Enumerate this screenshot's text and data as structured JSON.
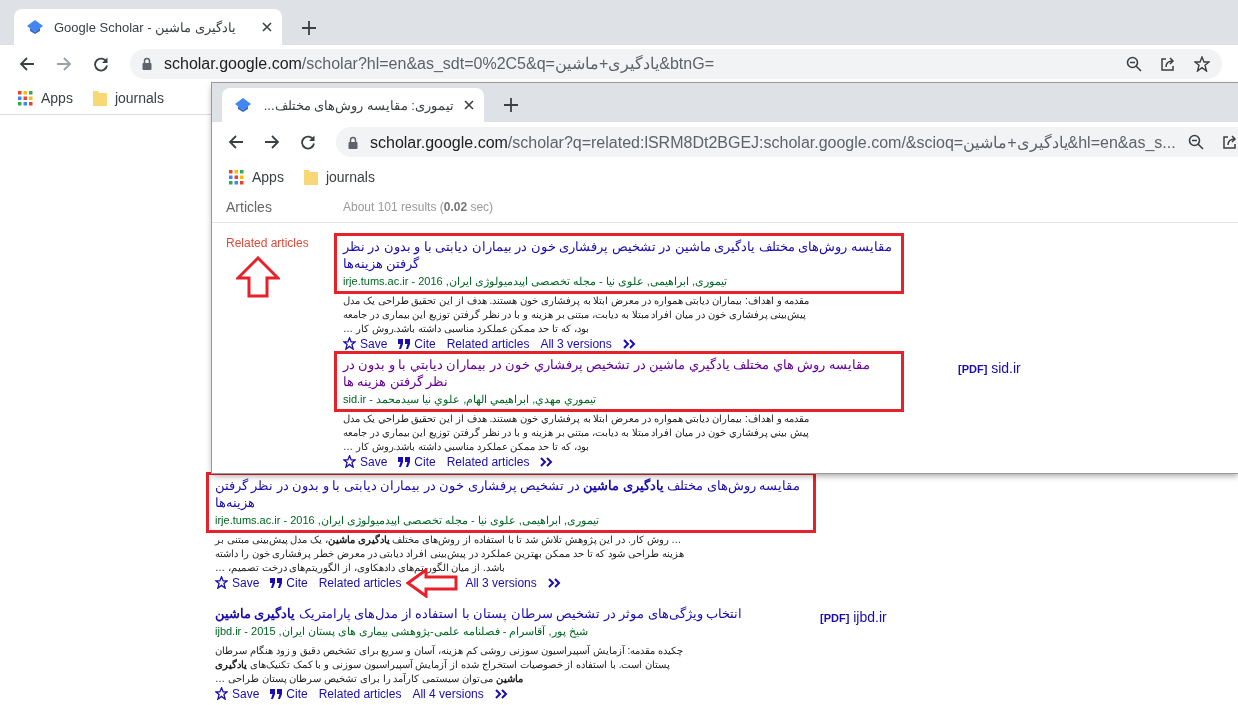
{
  "outer_window": {
    "tabs": [
      {
        "title": "Google Scholar - یادگیری ماشین",
        "selected": true
      }
    ],
    "url": {
      "host": "scholar.google.com",
      "path": "/scholar?hl=en&as_sdt=0%2C5&q=یادگیری+ماشین&btnG="
    },
    "bookmarks": {
      "apps": "Apps",
      "folder": "journals"
    },
    "results": [
      {
        "title": "مقایسه روش‌های مختلف **یادگیری ماشین** در تشخیص پرفشاری خون در بیماران دیابتی با و بدون در نظر گرفتن هزینه‌ها",
        "visited": false,
        "highlighted": true,
        "pointed_at": true,
        "authors": "تیموری, ابراهیمی, علوی نیا - مجله تخصصی اپیدمیولوژی ایران, 2016 - irje.tums.ac.ir",
        "snippet": "… روش کار. در این پژوهش تلاش شد تا با استفاده از روش‌های مختلف **یادگیری ماشین**، یک مدل پیش‌بینی مبتنی بر هزینه طراحی شود که تا حد ممکن بهترین عملکرد در پیش‌بینی افراد دیابتی در معرض خطر پرفشاری خون را داشته باشد. از میان الگوریتم‌های دادهکاوی، از الگوریتم‌های درخت تصمیم، …",
        "actions": {
          "save": "Save",
          "cite": "Cite",
          "related": "Related articles",
          "versions": "All 3 versions"
        }
      },
      {
        "title": "انتخاب ویژگی‌های موثر در تشخیص سرطان پستان با استفاده از مدل‌های پارامتریک **یادگیری ماشین**",
        "visited": false,
        "highlighted": false,
        "pdf_link": "**[PDF]** ijbd.ir",
        "authors": "شیخ پور, آقاسرام - فصلنامه علمی-پژوهشی بیماری های پستان ایران, 2015 - ijbd.ir",
        "snippet": "چکیده مقدمه: آزمایش آسپیراسیون سوزنی روشی کم هزینه، آسان و سریع برای تشخیص دقیق و زود هنگام سرطان پستان است. با استفاده از خصوصیات استخراج شده از آزمایش آسپیراسیون سوزنی و با کمک تکنیک‌های **یادگیری ماشین** می‌توان سیستمی کارآمد را برای تشخیص سرطان پستان طراحی …",
        "actions": {
          "save": "Save",
          "cite": "Cite",
          "related": "Related articles",
          "versions": "All 4 versions"
        }
      }
    ]
  },
  "inner_window": {
    "tabs": [
      {
        "title": "تیموری: مقایسه روش‌های مختلف...",
        "selected": true
      }
    ],
    "url": {
      "host": "scholar.google.com",
      "path": "/scholar?q=related:lSRM8Dt2BGEJ:scholar.google.com/&scioq=یادگیری+ماشین&hl=en&as_s..."
    },
    "bookmarks": {
      "apps": "Apps",
      "folder": "journals"
    },
    "section": "Articles",
    "result_stats": "About 101 results (**0.02** sec)",
    "sidebar_link": "Related articles",
    "sidebar_link_pointed_at": true,
    "results": [
      {
        "title": "مقایسه روش‌های مختلف یادگیری ماشین در تشخیص پرفشاری خون در بیماران دیابتی با و بدون در نظر گرفتن هزینه‌ها",
        "visited": false,
        "highlighted": true,
        "authors": "تیموری, ابراهیمی, علوی نیا - مجله تخصصی اپیدمیولوژی ایران, 2016 - irje.tums.ac.ir",
        "snippet": "مقدمه و اهداف: بیماران دیابتی همواره در معرض ابتلا به پرفشاری خون هستند. هدف از این تحقیق طراحی یک مدل پیش‌بینی پرفشاری خون در میان افراد مبتلا به دیابت، مبتنی بر هزینه و با در نظر گرفتن توزیع این بیماری در جامعه بود، که تا حد ممکن عملکرد مناسبی داشته باشد.روش کار …",
        "actions": {
          "save": "Save",
          "cite": "Cite",
          "related": "Related articles",
          "versions": "All 3 versions"
        }
      },
      {
        "title": "مقايسه روش هاي مختلف يادگيري ماشين در تشخيص پرفشاري خون در بيماران ديابتي با و بدون در نظر گرفتن هزينه ها",
        "visited": true,
        "highlighted": true,
        "pdf_link": "**[PDF]** sid.ir",
        "authors": "تيموري مهدي, ابراهيمي الهام, علوي نيا سيدمحمد - sid.ir",
        "snippet": "مقدمه و اهداف: بيماران ديابتي همواره در معرض ابتلا به پرفشاري خون هستند. هدف از اين تحقيق طراحي يک مدل پيش بيني پرفشاري خون در ميان افراد مبتلا به ديابت، مبتني بر هزينه و با در نظر گرفتن توزيع اين بيماري در جامعه بود، که تا حد ممکن عملکرد مناسبي داشته باشد.روش کار …",
        "actions": {
          "save": "Save",
          "cite": "Cite",
          "related": "Related articles"
        }
      }
    ]
  }
}
